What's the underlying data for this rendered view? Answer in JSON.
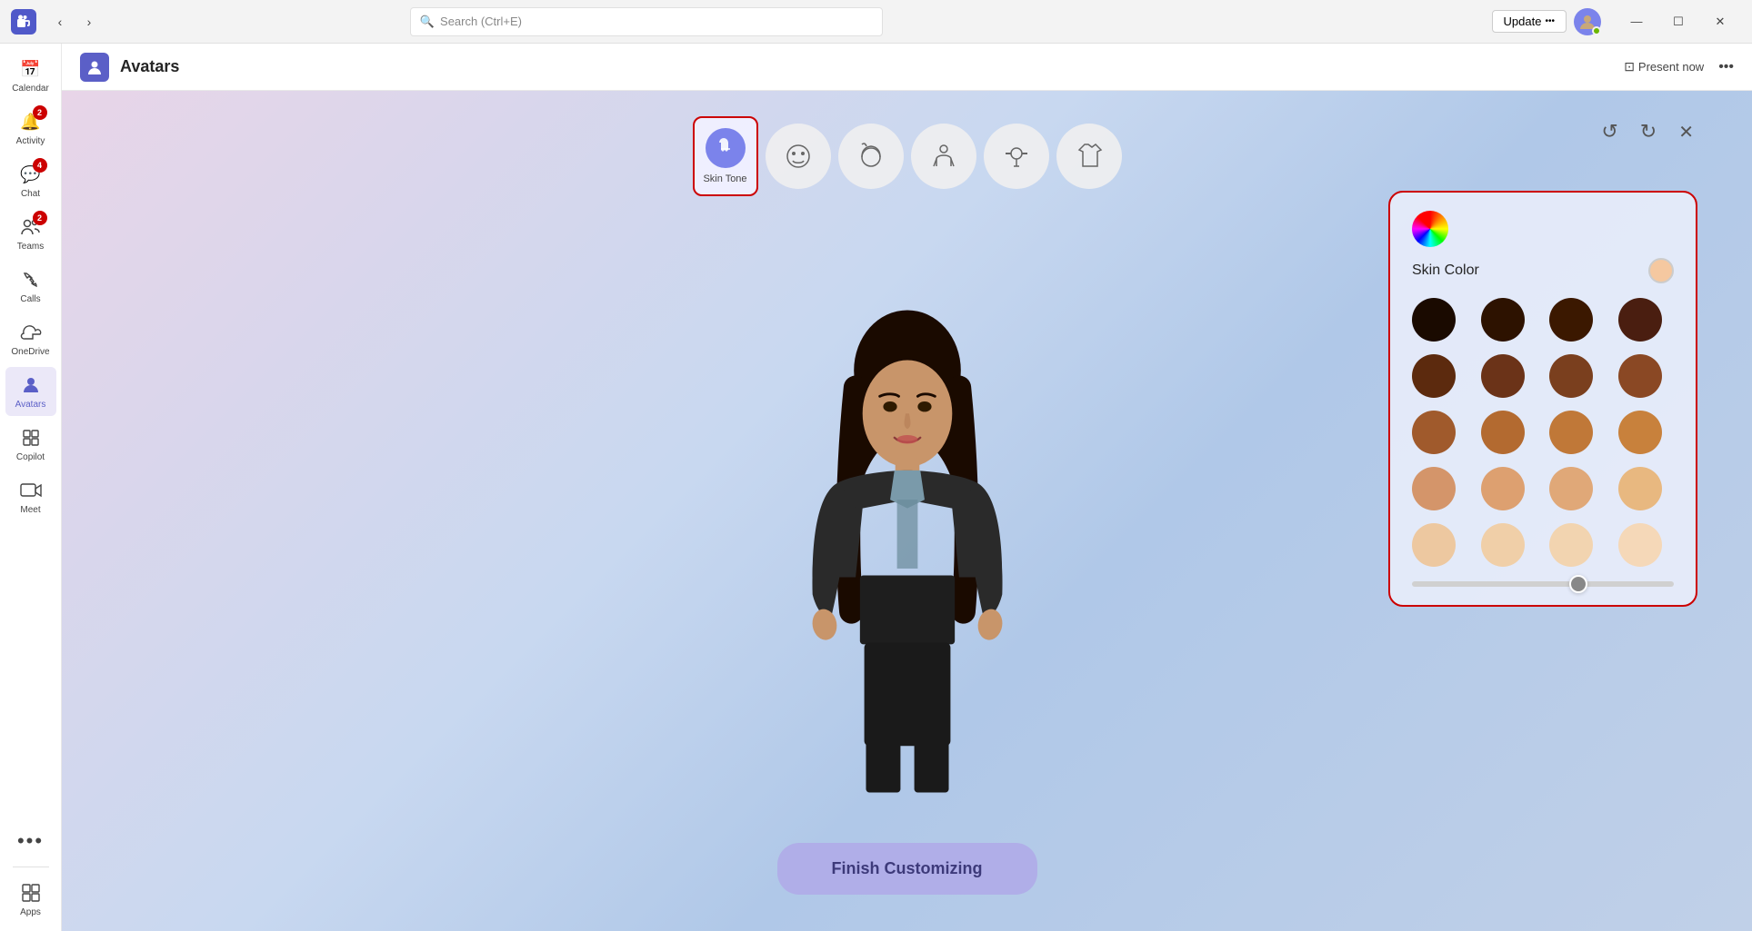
{
  "titlebar": {
    "logo": "T",
    "nav_back": "‹",
    "nav_forward": "›",
    "search_placeholder": "Search (Ctrl+E)",
    "update_label": "Update",
    "update_dots": "•••",
    "minimize": "—",
    "maximize": "☐",
    "close": "✕"
  },
  "sidebar": {
    "items": [
      {
        "id": "calendar",
        "label": "Calendar",
        "icon": "📅",
        "badge": null,
        "active": false
      },
      {
        "id": "activity",
        "label": "Activity",
        "icon": "🔔",
        "badge": "2",
        "active": false
      },
      {
        "id": "chat",
        "label": "Chat",
        "icon": "💬",
        "badge": "4",
        "active": false
      },
      {
        "id": "teams",
        "label": "Teams",
        "icon": "👥",
        "badge": "2",
        "active": false
      },
      {
        "id": "calls",
        "label": "Calls",
        "icon": "📞",
        "badge": null,
        "active": false
      },
      {
        "id": "onedrive",
        "label": "OneDrive",
        "icon": "☁",
        "badge": null,
        "active": false
      },
      {
        "id": "avatars",
        "label": "Avatars",
        "icon": "👤",
        "badge": null,
        "active": true
      },
      {
        "id": "copilot",
        "label": "Copilot",
        "icon": "⧉",
        "badge": null,
        "active": false
      },
      {
        "id": "meet",
        "label": "Meet",
        "icon": "🎥",
        "badge": null,
        "active": false
      },
      {
        "id": "more",
        "label": "•••",
        "icon": "•••",
        "badge": null,
        "active": false
      },
      {
        "id": "apps",
        "label": "Apps",
        "icon": "⊞",
        "badge": null,
        "active": false
      }
    ]
  },
  "page_header": {
    "icon": "👤",
    "title": "Avatars",
    "present_now": "Present now",
    "more_icon": "•••"
  },
  "toolbar": {
    "items": [
      {
        "id": "skin-tone",
        "label": "Skin Tone",
        "icon": "✋",
        "active": true
      },
      {
        "id": "face",
        "label": "",
        "icon": "😊",
        "active": false
      },
      {
        "id": "hair",
        "label": "",
        "icon": "👤",
        "active": false
      },
      {
        "id": "body",
        "label": "",
        "icon": "⚇",
        "active": false
      },
      {
        "id": "accessories",
        "label": "",
        "icon": "🤸",
        "active": false
      },
      {
        "id": "clothing",
        "label": "",
        "icon": "👕",
        "active": false
      }
    ],
    "undo": "↺",
    "redo": "↻",
    "close": "✕"
  },
  "skin_panel": {
    "title": "Skin Color",
    "colors": [
      {
        "row": 0,
        "swatches": [
          "#1a0a00",
          "#2d1200",
          "#3b1800",
          "#4a1e10"
        ]
      },
      {
        "row": 1,
        "swatches": [
          "#5c2a0e",
          "#6b3318",
          "#7a3f1e",
          "#8a4824"
        ]
      },
      {
        "row": 2,
        "swatches": [
          "#a05a2c",
          "#b36a30",
          "#c07838",
          "#c8813c"
        ]
      },
      {
        "row": 3,
        "swatches": [
          "#d4956a",
          "#dda070",
          "#e0a878",
          "#e8b880"
        ]
      },
      {
        "row": 4,
        "swatches": [
          "#edc8a0",
          "#f0cfa8",
          "#f2d4b0",
          "#f5d8b8"
        ]
      }
    ],
    "selected_color": "#f5c8a0",
    "slider_value": 60
  },
  "finish_btn": "Finish Customizing"
}
